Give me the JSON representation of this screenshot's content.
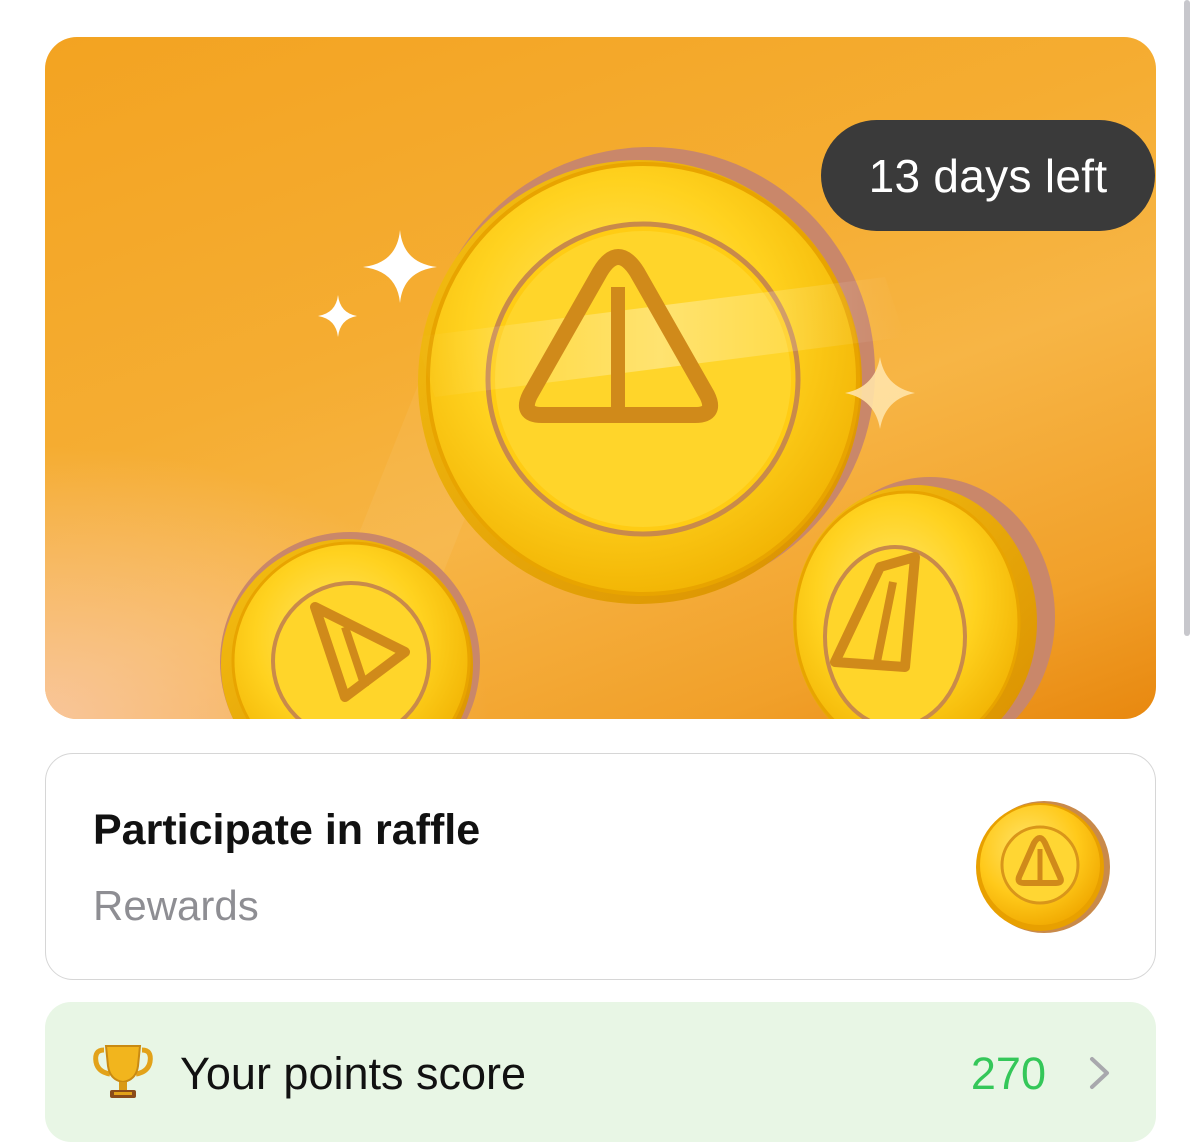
{
  "banner": {
    "countdown_label": "13 days left"
  },
  "raffle": {
    "title": "Participate in raffle",
    "subtitle": "Rewards",
    "icon": "coin-icon"
  },
  "points": {
    "icon": "trophy-icon",
    "label": "Your points score",
    "value": "270",
    "chevron": "chevron-right-icon"
  },
  "colors": {
    "banner_orange": "#f3a321",
    "pill_bg": "#3a3a3a",
    "points_row_bg": "#e8f6e5",
    "points_value": "#34c759",
    "subtitle_gray": "#8e8e93"
  }
}
